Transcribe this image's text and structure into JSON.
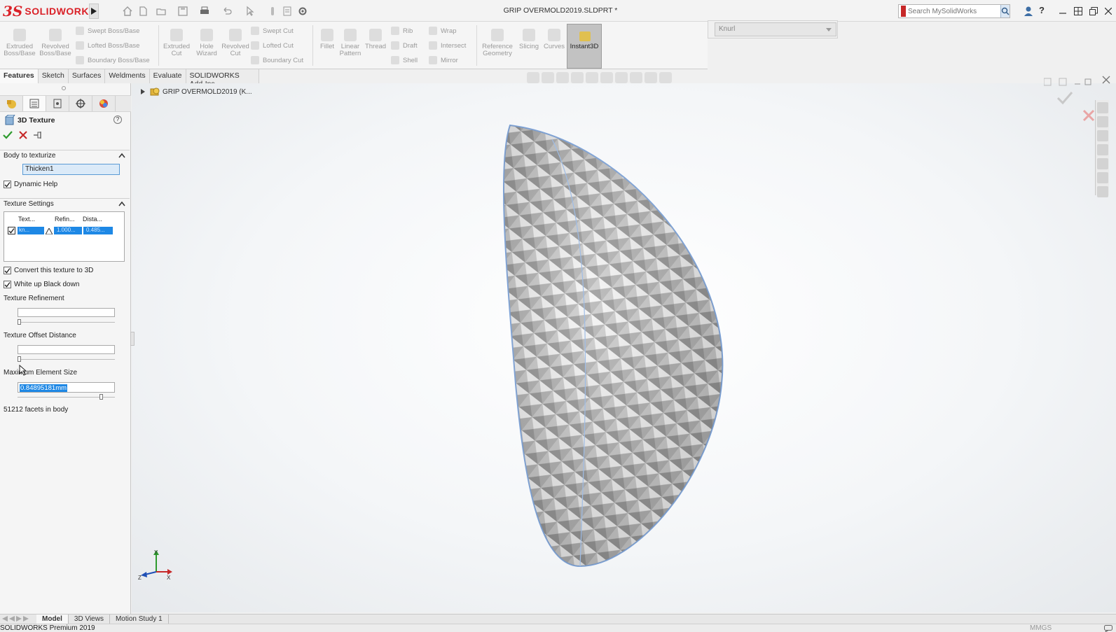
{
  "app": {
    "brand": "SOLIDWORKS",
    "title": "GRIP OVERMOLD2019.SLDPRT *"
  },
  "search": {
    "placeholder": "Search MySolidWorks"
  },
  "command_manager": {
    "big": [
      {
        "label": "Extruded Boss/Base"
      },
      {
        "label": "Revolved Boss/Base"
      },
      {
        "label": "Extruded Cut"
      },
      {
        "label": "Hole Wizard"
      },
      {
        "label": "Revolved Cut"
      },
      {
        "label": "Fillet"
      },
      {
        "label": "Linear Pattern"
      },
      {
        "label": "Thread"
      },
      {
        "label": "Reference Geometry"
      },
      {
        "label": "Slicing"
      },
      {
        "label": "Curves"
      }
    ],
    "small_boss": [
      "Swept Boss/Base",
      "Lofted Boss/Base",
      "Boundary Boss/Base"
    ],
    "small_cut": [
      "Swept Cut",
      "Lofted Cut",
      "Boundary Cut"
    ],
    "small_feat1": [
      "Rib",
      "Draft",
      "Shell"
    ],
    "small_feat2": [
      "Wrap",
      "Intersect",
      "Mirror"
    ],
    "instant3d": "Instant3D",
    "texture_dropdown": "Knurl"
  },
  "tabs": [
    "Features",
    "Sketch",
    "Surfaces",
    "Weldments",
    "Evaluate",
    "SOLIDWORKS Add-Ins"
  ],
  "panel": {
    "title": "3D Texture",
    "help": "?",
    "body_section": "Body to texturize",
    "body_value": "Thicken1",
    "dynamic_help": "Dynamic Help",
    "texture_section": "Texture Settings",
    "table_headers": [
      "Text...",
      "Refin...",
      "Dista..."
    ],
    "table_row": [
      "kn...",
      "1.000...",
      "0.485..."
    ],
    "convert": "Convert this texture to 3D",
    "white_up": "White up Black down",
    "refinement_label": "Texture Refinement",
    "offset_label": "Texture Offset Distance",
    "max_element_label": "Maximum Element Size",
    "max_element_value": "0.84895181mm",
    "facets": "51212 facets in body",
    "refinement_level": 0.0,
    "offset_level": 0.0,
    "max_element_level": 0.88
  },
  "tree": {
    "root": "GRIP OVERMOLD2019 (K..."
  },
  "triad": {
    "x": "X",
    "y": "Y",
    "z": "Z"
  },
  "bottom_tabs": [
    "Model",
    "3D Views",
    "Motion Study 1"
  ],
  "status": {
    "product": "SOLIDWORKS Premium 2019",
    "units": "MMGS"
  },
  "colors": {
    "brand": "#da2128",
    "accept": "#2e9b2e",
    "cancel": "#c62828",
    "selection": "#1e88e5"
  }
}
